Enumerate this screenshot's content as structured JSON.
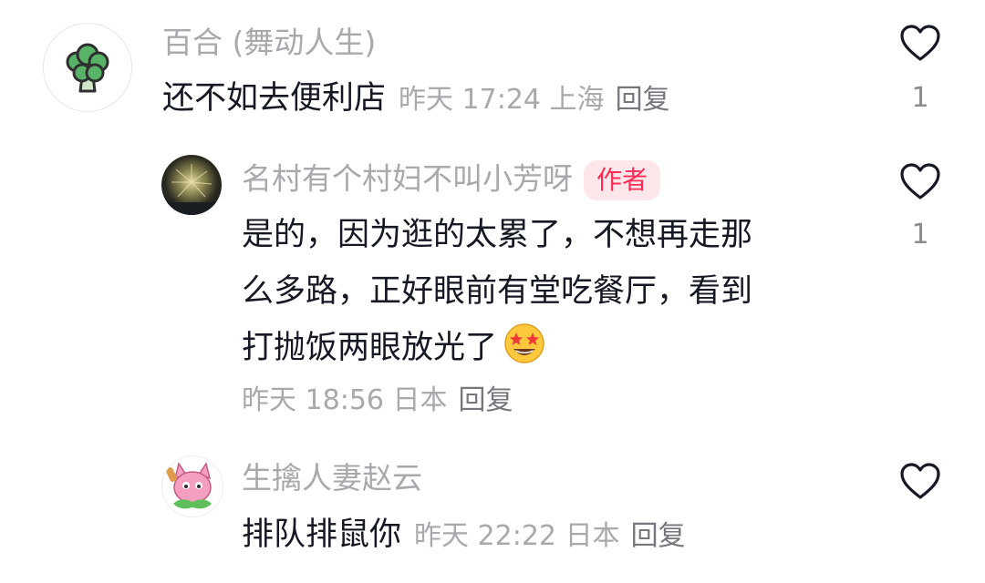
{
  "comments": [
    {
      "username": "百合 (舞动人生)",
      "avatar_icon": "broccoli-icon",
      "text": "还不如去便利店",
      "time": "昨天 17:24",
      "location": "上海",
      "reply": "回复",
      "likes": "1"
    },
    {
      "username": "名村有个村妇不叫小芳呀",
      "badge": "作者",
      "avatar_icon": "fireworks-avatar",
      "text_lines": [
        "是的，因为逛的太累了，不想再走那",
        "么多路，正好眼前有堂吃餐厅，看到",
        "打抛饭两眼放光了"
      ],
      "emoji_icon": "star-struck-emoji",
      "time": "昨天 18:56",
      "location": "日本",
      "reply": "回复",
      "likes": "1"
    },
    {
      "username": "生擒人妻赵云",
      "avatar_icon": "pink-cat-avatar",
      "text": "排队排鼠你",
      "time": "昨天 22:22",
      "location": "日本",
      "reply": "回复"
    }
  ],
  "colors": {
    "username": "#a9a9ad",
    "text": "#161823",
    "badge_bg": "#fde7ea",
    "badge_text": "#fe2c55"
  }
}
